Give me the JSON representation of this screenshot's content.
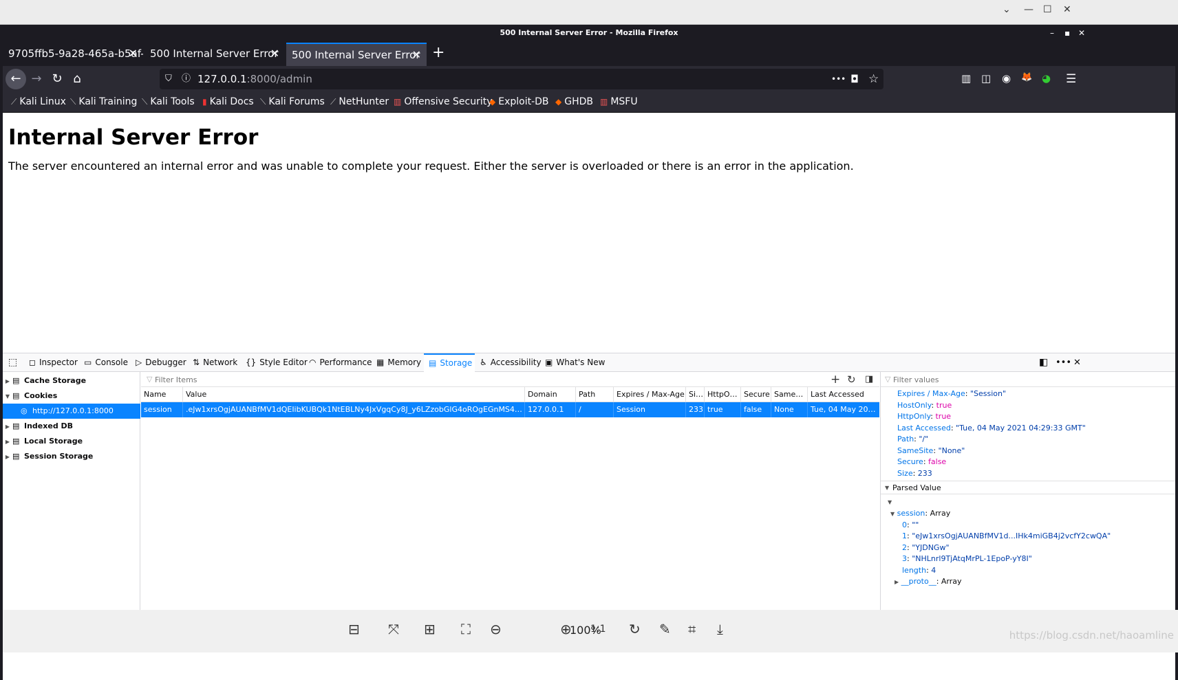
{
  "os_topbar": {
    "buttons": [
      "⌄",
      "—",
      "☐",
      "✕"
    ]
  },
  "window": {
    "title": "500 Internal Server Error - Mozilla Firefox",
    "controls": [
      "–",
      "▪",
      "✕"
    ]
  },
  "tabs": [
    {
      "label": "9705ffb5-9a28-465a-b5af-",
      "close": "✕"
    },
    {
      "label": "500 Internal Server Error",
      "close": "✕"
    },
    {
      "label": "500 Internal Server Error",
      "close": "✕"
    }
  ],
  "new_tab": "+",
  "nav": {
    "back": "←",
    "forward": "→",
    "reload": "↻",
    "home": "⌂"
  },
  "url": {
    "host": "127.0.0.1",
    "rest": ":8000/admin",
    "shield": "⛉",
    "info": "ⓘ",
    "more": "•••",
    "pocket": "◘",
    "star": "☆"
  },
  "toolbar_icons": [
    "▥",
    "◫",
    "◉",
    "🦊",
    "◕",
    "☰"
  ],
  "bookmarks": [
    "Kali Linux",
    "Kali Training",
    "Kali Tools",
    "Kali Docs",
    "Kali Forums",
    "NetHunter",
    "Offensive Security",
    "Exploit-DB",
    "GHDB",
    "MSFU"
  ],
  "page": {
    "heading": "Internal Server Error",
    "message": "The server encountered an internal error and was unable to complete your request. Either the server is overloaded or there is an error in the application."
  },
  "devtools": {
    "tabs": [
      "Inspector",
      "Console",
      "Debugger",
      "Network",
      "Style Editor",
      "Performance",
      "Memory",
      "Storage",
      "Accessibility",
      "What's New"
    ],
    "active_tab": "Storage",
    "sidebar": [
      "Cache Storage",
      "Cookies",
      "http://127.0.0.1:8000",
      "Indexed DB",
      "Local Storage",
      "Session Storage"
    ],
    "filter_items": "Filter Items",
    "filter_values": "Filter values",
    "columns": [
      "Name",
      "Value",
      "Domain",
      "Path",
      "Expires / Max-Age",
      "Size",
      "HttpOnly",
      "Secure",
      "SameSite",
      "Last Accessed"
    ],
    "row": [
      "session",
      ".eJw1xrsOgjAUANBfMV1dQEIibKUBQk1NtEBLNy4JxVgqCy8J_y6LZzobGlG4oROgEGnMS4H_CCMpdWux...",
      "127.0.0.1",
      "/",
      "Session",
      "233",
      "true",
      "false",
      "None",
      "Tue, 04 May 2021 0..."
    ],
    "details": [
      {
        "k": "Expires / Max-Age",
        "v": "\"Session\"",
        "t": "s"
      },
      {
        "k": "HostOnly",
        "v": "true",
        "t": "b"
      },
      {
        "k": "HttpOnly",
        "v": "true",
        "t": "b"
      },
      {
        "k": "Last Accessed",
        "v": "\"Tue, 04 May 2021 04:29:33 GMT\"",
        "t": "s"
      },
      {
        "k": "Path",
        "v": "\"/\"",
        "t": "s"
      },
      {
        "k": "SameSite",
        "v": "\"None\"",
        "t": "s"
      },
      {
        "k": "Secure",
        "v": "false",
        "t": "b"
      },
      {
        "k": "Size",
        "v": "233",
        "t": "n"
      }
    ],
    "parsed_header": "Parsed Value",
    "parsed": {
      "session_key": "session",
      "session_type": "Array",
      "items": [
        {
          "k": "0",
          "v": "\"\""
        },
        {
          "k": "1",
          "v": "\"eJw1xrsOgjAUANBfMV1d...IHk4miGB4j2vcfY2cwQA\""
        },
        {
          "k": "2",
          "v": "\"YJDNGw\""
        },
        {
          "k": "3",
          "v": "\"NHLnrl9TjAtqMrPL-1EpoP-yY8I\""
        },
        {
          "k": "length",
          "v": "4"
        }
      ],
      "proto_key": "__proto__",
      "proto_type": "Array"
    }
  },
  "viewer": {
    "zoom": "100%",
    "watermark": "https://blog.csdn.net/haoamline"
  }
}
